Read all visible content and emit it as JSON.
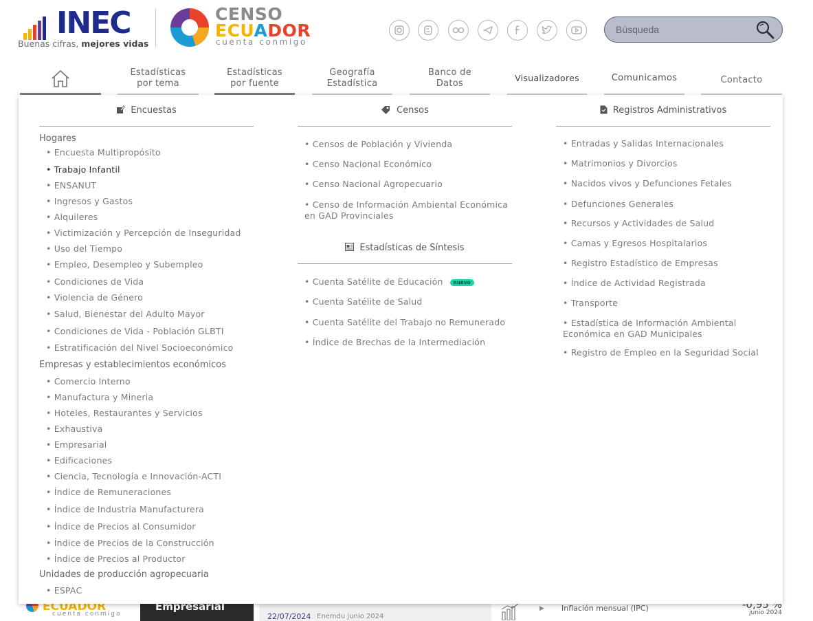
{
  "header": {
    "inec_logo_text": "INEC",
    "inec_tagline_1": "Buenas cifras,",
    "inec_tagline_2": "mejores vidas",
    "censo_line1": "CENSO",
    "censo_line2_a": "ECU",
    "censo_line2_b": "A",
    "censo_line2_c": "DOR",
    "censo_line3": "cuenta conmigo",
    "socials": [
      "instagram-icon",
      "blogger-icon",
      "flickr-icon",
      "telegram-icon",
      "facebook-icon",
      "twitter-icon",
      "youtube-icon"
    ],
    "search_placeholder": "Búsqueda"
  },
  "nav": {
    "home": "home-icon",
    "items": [
      {
        "line1": "Estadísticas",
        "line2": "por tema"
      },
      {
        "line1": "Estadísticas",
        "line2": "por fuente"
      },
      {
        "line1": "Geografía",
        "line2": "Estadística"
      },
      {
        "line1": "Banco de",
        "line2": "Datos"
      },
      {
        "line1": "Visualizadores",
        "line2": ""
      },
      {
        "line1": "Comunicamos",
        "line2": ""
      },
      {
        "line1": "Contacto",
        "line2": ""
      }
    ]
  },
  "menu": {
    "encuestas": {
      "title": "Encuestas",
      "hogares": "Hogares",
      "hogares_items": [
        "Encuesta Multipropósito",
        "Trabajo Infantil",
        "ENSANUT",
        "Ingresos y Gastos",
        "Alquileres",
        "Victimización y Percepción de Inseguridad",
        "Uso del Tiempo",
        "Empleo, Desempleo y Subempleo",
        "Condiciones de Vida",
        "Violencia de Género",
        "Salud, Bienestar del Adulto Mayor",
        "Condiciones de Vida - Población GLBTI",
        "Estratificación del Nivel Socioeconómico"
      ],
      "empresas": "Empresas y establecimientos económicos",
      "empresas_items": [
        "Comercio Interno",
        "Manufactura y Mineria",
        "Hoteles, Restaurantes y Servicios",
        "Exhaustiva",
        "Empresarial",
        "Edificaciones",
        "Ciencia, Tecnología e Innovación-ACTI",
        "Índice de Remuneraciones",
        "Índice de Industria Manufacturera",
        "Índice de Precios al Consumidor",
        "Índice de Precios de la Construcción",
        "Índice de Precios al Productor"
      ],
      "agro": "Unidades de producción agropecuaria",
      "agro_items": [
        "ESPAC"
      ]
    },
    "censos": {
      "title": "Censos",
      "items": [
        "Censos de Población y Vivienda",
        "Censo Nacional Económico",
        "Censo Nacional Agropecuario",
        "Censo de Información Ambiental Económica en GAD Provinciales"
      ]
    },
    "sintesis": {
      "title": "Estadísticas de Síntesis",
      "items": [
        "Cuenta Satélite de Educación",
        "Cuenta Satélite de Salud",
        "Cuenta Satélite del Trabajo no Remunerado",
        "Índice de Brechas de la Intermediación"
      ],
      "badge": "nuevo"
    },
    "registros": {
      "title": "Registros Administrativos",
      "items": [
        "Entradas y Salidas Internacionales",
        "Matrimonios y Divorcios",
        "Nacidos vivos y Defunciones Fetales",
        "Defunciones Generales",
        "Recursos y Actividades de Salud",
        "Camas y Egresos Hospitalarios",
        "Registro Estadístico de Empresas",
        "Índice de Actividad Registrada",
        "Transporte",
        "Estadística de Información Ambiental Económica en GAD Municipales",
        "Registro de Empleo en la Seguridad Social"
      ]
    }
  },
  "background": {
    "banner_text": "Empresarial",
    "date": "22/07/2024",
    "date_caption": "Enemdu junio 2024",
    "indicator_label": "Inflación mensual (IPC)",
    "indicator_value": "-0,95 %",
    "indicator_period": "junio 2024",
    "logo_a": "ECUADOR",
    "logo_b": "cuenta conmigo"
  }
}
